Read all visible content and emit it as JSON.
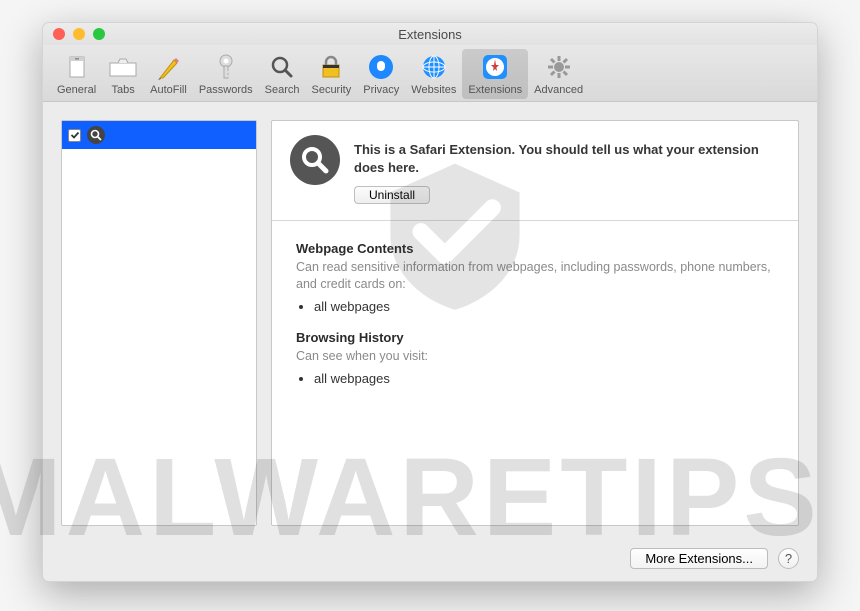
{
  "window": {
    "title": "Extensions"
  },
  "toolbar": {
    "items": [
      {
        "key": "general",
        "label": "General"
      },
      {
        "key": "tabs",
        "label": "Tabs"
      },
      {
        "key": "autofill",
        "label": "AutoFill"
      },
      {
        "key": "passwords",
        "label": "Passwords"
      },
      {
        "key": "search",
        "label": "Search"
      },
      {
        "key": "security",
        "label": "Security"
      },
      {
        "key": "privacy",
        "label": "Privacy"
      },
      {
        "key": "websites",
        "label": "Websites"
      },
      {
        "key": "extensions",
        "label": "Extensions"
      },
      {
        "key": "advanced",
        "label": "Advanced"
      }
    ],
    "active": "extensions"
  },
  "sidebar": {
    "items": [
      {
        "checked": true,
        "icon": "search-icon"
      }
    ]
  },
  "detail": {
    "description": "This is a Safari Extension. You should tell us what your extension does here.",
    "uninstall_label": "Uninstall",
    "permissions": [
      {
        "title": "Webpage Contents",
        "desc": "Can read sensitive information from webpages, including passwords, phone numbers, and credit cards on:",
        "list": [
          "all webpages"
        ]
      },
      {
        "title": "Browsing History",
        "desc": "Can see when you visit:",
        "list": [
          "all webpages"
        ]
      }
    ]
  },
  "footer": {
    "more_label": "More Extensions...",
    "help_label": "?"
  },
  "watermark": "MALWARETIPS"
}
